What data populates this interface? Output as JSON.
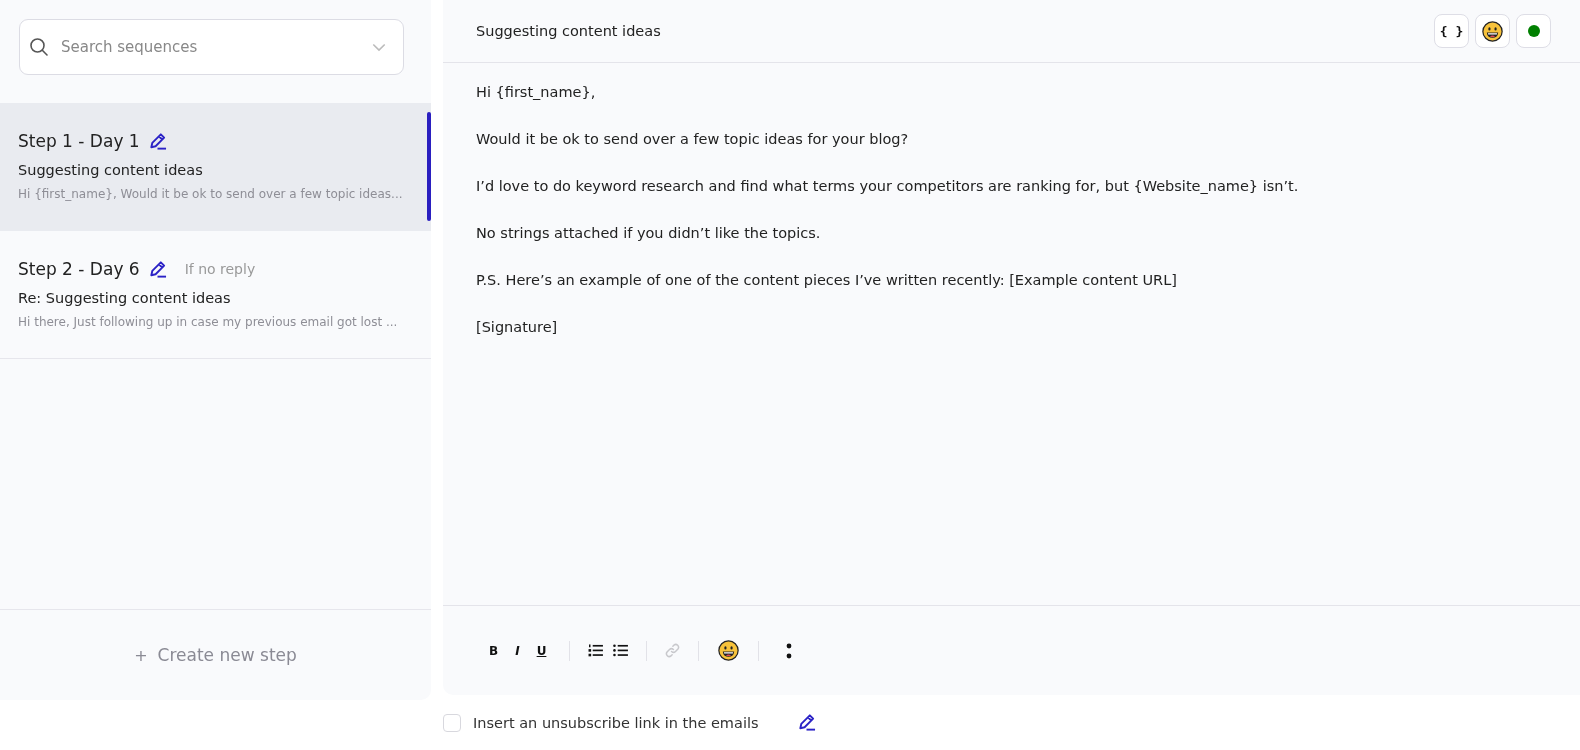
{
  "search": {
    "placeholder": "Search sequences"
  },
  "steps": [
    {
      "title": "Step 1 - Day 1",
      "subject": "Suggesting content ideas",
      "preview": "Hi {first_name}, Would it be ok to send over a few topic ideas...",
      "selected": true
    },
    {
      "title": "Step 2 - Day 6",
      "condition": "If no reply",
      "subject": "Re: Suggesting content ideas",
      "preview": "Hi there, Just following up in case my previous email got lost ...",
      "selected": false
    }
  ],
  "create_step": {
    "icon": "+",
    "label": "Create new step"
  },
  "editor": {
    "subject": "Suggesting content ideas",
    "header_buttons": [
      {
        "kind": "variables",
        "label": "{ }"
      },
      {
        "kind": "emoji"
      },
      {
        "kind": "status",
        "on": true
      }
    ],
    "body": [
      "Hi {first_name},",
      "Would it be ok to send over a few topic ideas for your blog?",
      "I’d love to do keyword research and find what terms your competitors are ranking for, but {Website_name} isn’t.",
      "No strings attached if you didn’t like the topics.",
      "P.S. Here’s an example of one of the content pieces I’ve written recently: [Example content URL]",
      "[Signature]"
    ],
    "toolbar": [
      [
        {
          "kind": "bold",
          "label": "B",
          "disabled": false
        },
        {
          "kind": "italic",
          "label": "I",
          "disabled": false
        },
        {
          "kind": "underline",
          "label": "U",
          "disabled": false
        }
      ],
      [
        {
          "kind": "ordered-list",
          "disabled": false
        },
        {
          "kind": "bullet-list",
          "disabled": false
        }
      ],
      [
        {
          "kind": "link",
          "disabled": true
        }
      ],
      [
        {
          "kind": "emoji",
          "disabled": false
        }
      ],
      [
        {
          "kind": "more",
          "disabled": false
        }
      ]
    ]
  },
  "unsubscribe": {
    "label": "Insert an unsubscribe link in the emails",
    "checked": false
  }
}
